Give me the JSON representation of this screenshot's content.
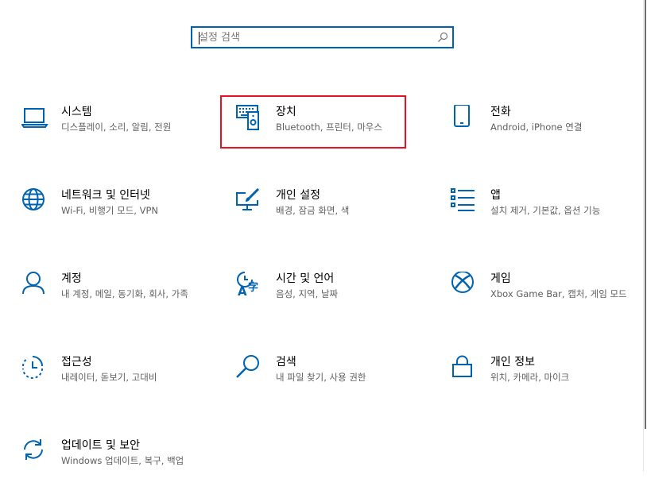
{
  "search": {
    "placeholder": "설정 검색"
  },
  "tiles": [
    {
      "title": "시스템",
      "desc": "디스플레이, 소리, 알림, 전원",
      "icon": "laptop-icon"
    },
    {
      "title": "장치",
      "desc": "Bluetooth, 프린터, 마우스",
      "icon": "keyboard-speaker-icon"
    },
    {
      "title": "전화",
      "desc": "Android, iPhone 연결",
      "icon": "phone-icon"
    },
    {
      "title": "네트워크 및 인터넷",
      "desc": "Wi-Fi, 비행기 모드, VPN",
      "icon": "globe-icon"
    },
    {
      "title": "개인 설정",
      "desc": "배경, 잠금 화면, 색",
      "icon": "paint-monitor-icon"
    },
    {
      "title": "앱",
      "desc": "설치 제거, 기본값, 옵션 기능",
      "icon": "apps-list-icon"
    },
    {
      "title": "계정",
      "desc": "내 계정, 메일, 동기화, 회사, 가족",
      "icon": "person-icon"
    },
    {
      "title": "시간 및 언어",
      "desc": "음성, 지역, 날짜",
      "icon": "time-language-icon"
    },
    {
      "title": "게임",
      "desc": "Xbox Game Bar, 캡처, 게임 모드",
      "icon": "xbox-icon"
    },
    {
      "title": "접근성",
      "desc": "내레이터, 돋보기, 고대비",
      "icon": "ease-of-access-icon"
    },
    {
      "title": "검색",
      "desc": "내 파일 찾기, 사용 권한",
      "icon": "search-icon"
    },
    {
      "title": "개인 정보",
      "desc": "위치, 카메라, 마이크",
      "icon": "lock-icon"
    },
    {
      "title": "업데이트 및 보안",
      "desc": "Windows 업데이트, 복구, 백업",
      "icon": "sync-icon"
    }
  ],
  "colors": {
    "accent": "#0063b1",
    "icon": "#0063b1",
    "highlight": "#e81123",
    "desc_text": "#5f5f5f"
  }
}
